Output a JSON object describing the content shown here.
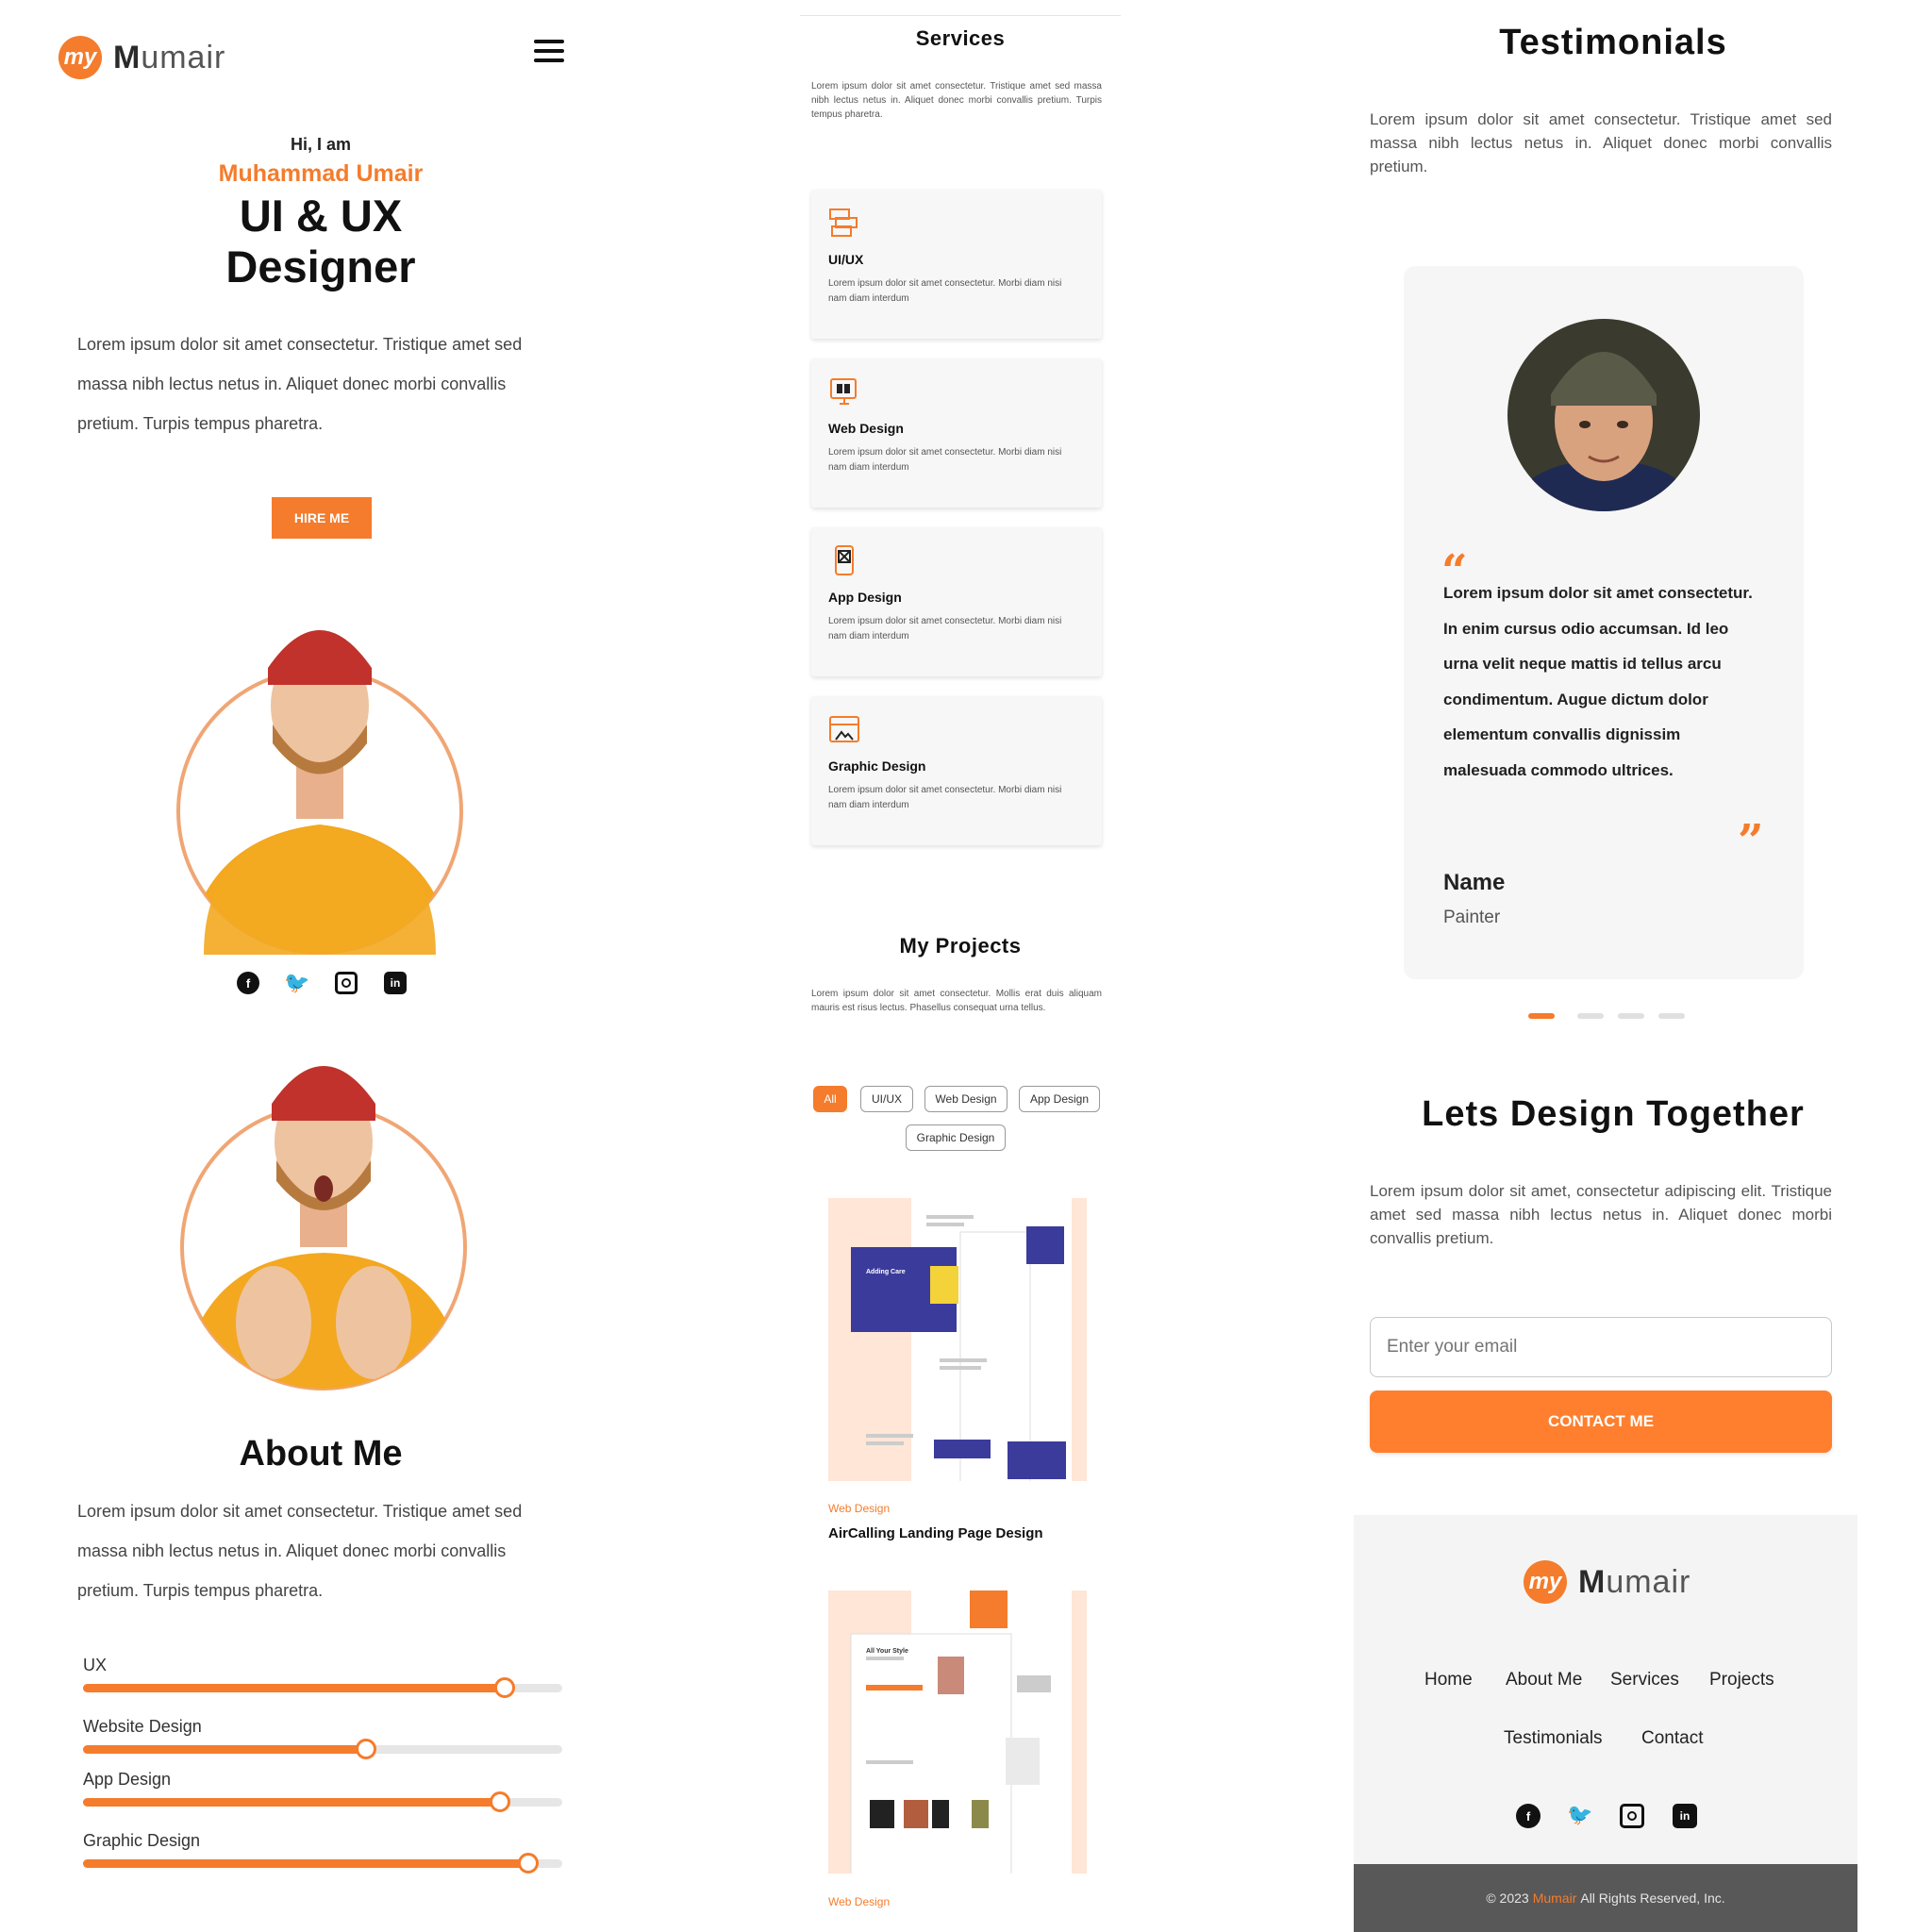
{
  "brand": {
    "name": "Mumair",
    "mark": "my",
    "accent": "#F47C2C"
  },
  "hero": {
    "greeting": "Hi, I am",
    "name": "Muhammad Umair",
    "role_line1": "UI & UX",
    "role_line2": "Designer",
    "intro": "Lorem ipsum dolor sit amet consectetur. Tristique amet sed massa nibh lectus netus in. Aliquet donec morbi convallis pretium. Turpis tempus pharetra.",
    "hire_button": "HIRE ME"
  },
  "social_icons": [
    "facebook-icon",
    "twitter-icon",
    "instagram-icon",
    "linkedin-icon"
  ],
  "about": {
    "title": "About Me",
    "text": "Lorem ipsum dolor sit amet consectetur. Tristique amet sed massa nibh lectus netus in. Aliquet donec morbi convallis pretium. Turpis tempus pharetra."
  },
  "skills": [
    {
      "label": "UX",
      "level": 0.88
    },
    {
      "label": "Website Design",
      "level": 0.59
    },
    {
      "label": "App Design",
      "level": 0.87
    },
    {
      "label": "Graphic Design",
      "level": 0.93
    }
  ],
  "services": {
    "title": "Services",
    "intro": "Lorem ipsum dolor sit amet consectetur. Tristique amet sed massa nibh lectus netus in. Aliquet donec morbi convallis pretium. Turpis tempus pharetra.",
    "items": [
      {
        "title": "UI/UX",
        "desc": "Lorem ipsum dolor sit amet consectetur. Morbi diam nisi nam diam interdum",
        "icon": "ui-ux-icon"
      },
      {
        "title": "Web Design",
        "desc": "Lorem ipsum dolor sit amet consectetur. Morbi diam nisi nam diam interdum",
        "icon": "web-design-icon"
      },
      {
        "title": "App Design",
        "desc": "Lorem ipsum dolor sit amet consectetur. Morbi diam nisi nam diam interdum",
        "icon": "app-design-icon"
      },
      {
        "title": "Graphic Design",
        "desc": "Lorem ipsum dolor sit amet consectetur. Morbi diam nisi nam diam interdum",
        "icon": "graphic-design-icon"
      }
    ]
  },
  "projects": {
    "title": "My Projects",
    "intro": "Lorem ipsum dolor sit amet consectetur. Mollis erat duis aliquam mauris est risus lectus. Phasellus consequat urna tellus.",
    "filters": [
      "All",
      "UI/UX",
      "Web Design",
      "App Design",
      "Graphic Design"
    ],
    "active_filter": "All",
    "items": [
      {
        "category": "Web Design",
        "name": "AirCalling Landing Page Design",
        "thumb_text": "Adding Care through Voice Calls."
      },
      {
        "category": "Web Design",
        "name": "",
        "thumb_text": "All Your Style Are Here"
      }
    ]
  },
  "testimonials": {
    "title": "Testimonials",
    "intro": "Lorem ipsum dolor sit amet consectetur. Tristique amet sed massa nibh lectus netus in. Aliquet donec morbi convallis pretium.",
    "quote": "Lorem ipsum dolor sit amet consectetur. In enim cursus odio accumsan. Id leo urna velit neque mattis id tellus arcu condimentum. Augue dictum dolor elementum convallis dignissim malesuada commodo ultrices.",
    "open_quote": "“",
    "close_quote": "”",
    "person_name": "Name",
    "person_role": "Painter",
    "slides": 4,
    "active_slide": 1
  },
  "contact": {
    "title": "Lets Design Together",
    "text": "Lorem ipsum dolor sit amet, consectetur adipiscing elit. Tristique amet sed massa nibh lectus netus in. Aliquet donec morbi convallis pretium.",
    "email_placeholder": "Enter your email",
    "button": "CONTACT ME"
  },
  "footer": {
    "nav": [
      "Home",
      "About Me",
      "Services",
      "Projects",
      "Testimonials",
      "Contact"
    ],
    "copyright_prefix": "© 2023",
    "copyright_brand": "Mumair",
    "copyright_suffix": "All Rights Reserved, Inc."
  }
}
